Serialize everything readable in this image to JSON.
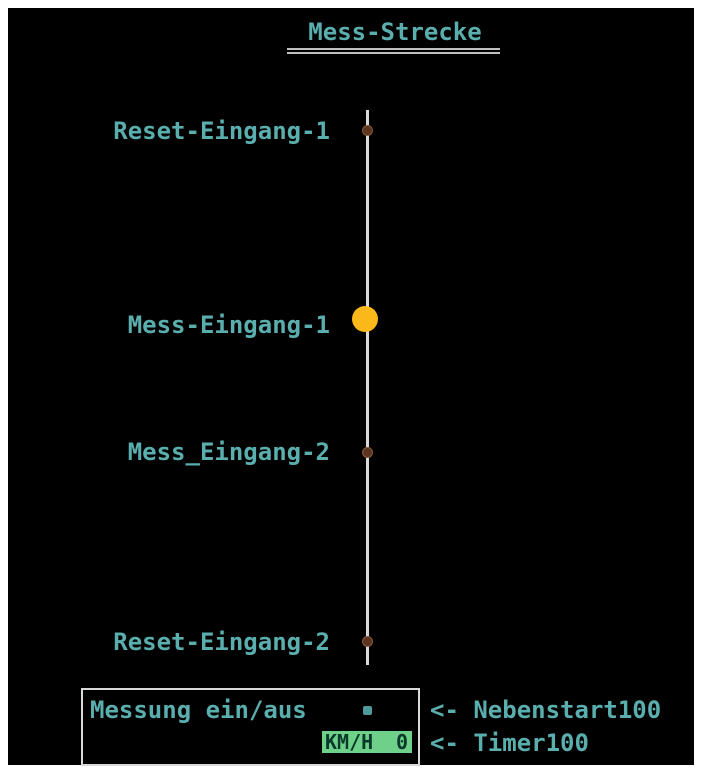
{
  "title": "Mess-Strecke",
  "nodes": [
    {
      "label": "Reset-Eingang-1",
      "active": false
    },
    {
      "label": "Mess-Eingang-1",
      "active": true
    },
    {
      "label": "Mess_Eingang-2",
      "active": false
    },
    {
      "label": "Reset-Eingang-2",
      "active": false
    }
  ],
  "panel": {
    "toggle_label": "Messung ein/aus",
    "unit": "KM/H",
    "speed_value": "0"
  },
  "annotations": {
    "toggle_source": "<- Nebenstart100",
    "speed_source": "<- Timer100"
  },
  "colors": {
    "background": "#000000",
    "text": "#5aaeae",
    "track": "#d9d9d9",
    "active_node": "#fbb81b",
    "inactive_node": "#5a3420",
    "display_bg": "#6fd08a"
  }
}
